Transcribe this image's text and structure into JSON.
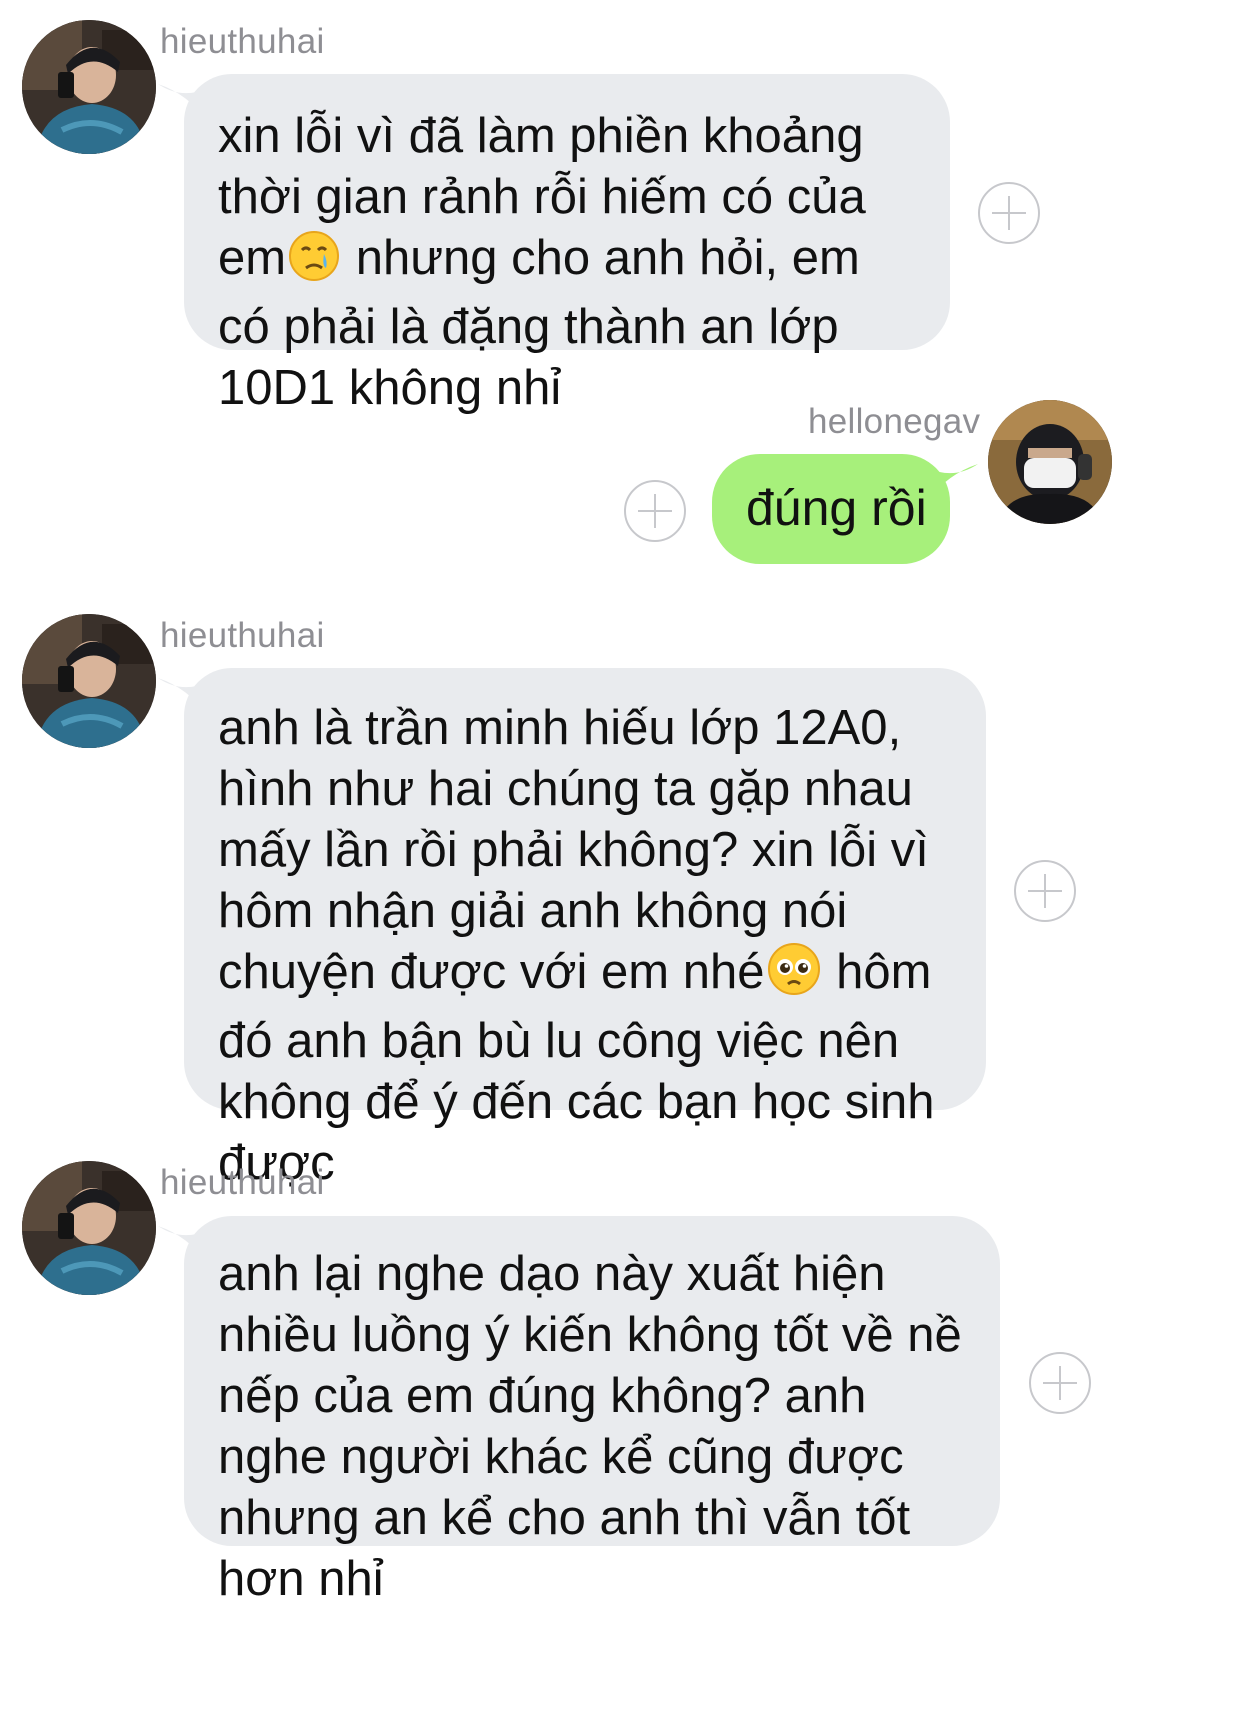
{
  "messages": [
    {
      "sender": "hieuthuhai",
      "direction": "incoming",
      "before_emoji": "xin lỗi vì đã làm phiền khoảng thời gian rảnh rỗi hiếm có của em",
      "emoji": "crying-face",
      "after_emoji": " nhưng cho anh hỏi, em có phải là đặng thành an lớp 10D1 không nhỉ"
    },
    {
      "sender": "hellonegav",
      "direction": "outgoing",
      "text": "đúng rồi"
    },
    {
      "sender": "hieuthuhai",
      "direction": "incoming",
      "before_emoji": "anh là trần minh hiếu lớp 12A0, hình như hai chúng ta gặp nhau mấy lần rồi phải không? xin lỗi vì hôm nhận giải anh không nói chuyện được với em nhé",
      "emoji": "pleading-face",
      "after_emoji": " hôm đó anh bận bù lu công việc nên không để ý đến các bạn học sinh được"
    },
    {
      "sender": "hieuthuhai",
      "direction": "incoming",
      "text": "anh lại nghe dạo này xuất hiện nhiều luồng ý kiến không tốt về nề nếp của em đúng không? anh nghe người khác kể cũng được nhưng an kể cho anh thì vẫn tốt hơn nhỉ"
    }
  ],
  "colors": {
    "incoming_bubble": "#e9ebee",
    "outgoing_bubble": "#a7f07b",
    "name_text": "#8e8e93"
  },
  "icons": [
    "avatar-hieuthuhai",
    "avatar-hellonegav",
    "add-reaction-icon"
  ]
}
